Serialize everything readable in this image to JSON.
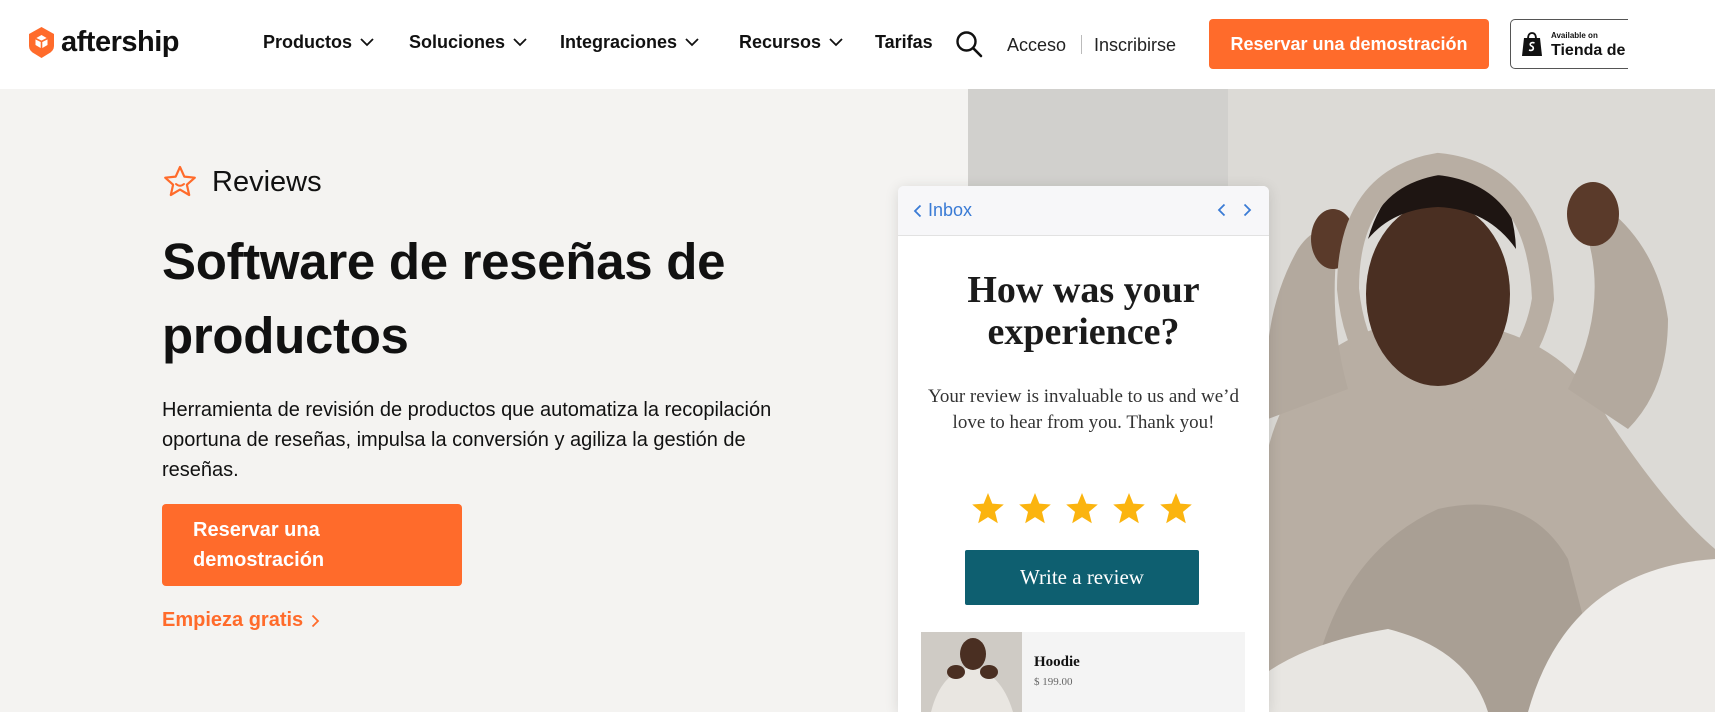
{
  "brand": {
    "name": "aftership",
    "accent": "#ff6b2b"
  },
  "nav": {
    "items": [
      {
        "label": "Productos"
      },
      {
        "label": "Soluciones"
      },
      {
        "label": "Integraciones"
      },
      {
        "label": "Recursos"
      },
      {
        "label": "Tarifas"
      }
    ],
    "search_icon": "search-icon",
    "login": "Acceso",
    "signup": "Inscribirse",
    "cta": "Reservar una demostración",
    "shopify_badge": {
      "small": "Available on",
      "big": "Tienda de"
    }
  },
  "hero": {
    "product_name": "Reviews",
    "product_icon": "star-icon",
    "title": "Software de reseñas de productos",
    "description": "Herramienta de revisión de productos que automatiza la recopilación oportuna de reseñas, impulsa la conversión y agiliza la gestión de reseñas.",
    "cta": "Reservar una demostración",
    "secondary_link": "Empieza gratis"
  },
  "email_mock": {
    "inbox_label": "Inbox",
    "heading": "How was your experience?",
    "body": "Your review is invaluable to us and we’d love to hear from you. Thank you!",
    "rating": {
      "value": 5,
      "max": 5,
      "color": "#fbb40f"
    },
    "button": "Write a review",
    "button_color": "#0e5f70",
    "product": {
      "name": "Hoodie",
      "price": "$ 199.00"
    }
  }
}
